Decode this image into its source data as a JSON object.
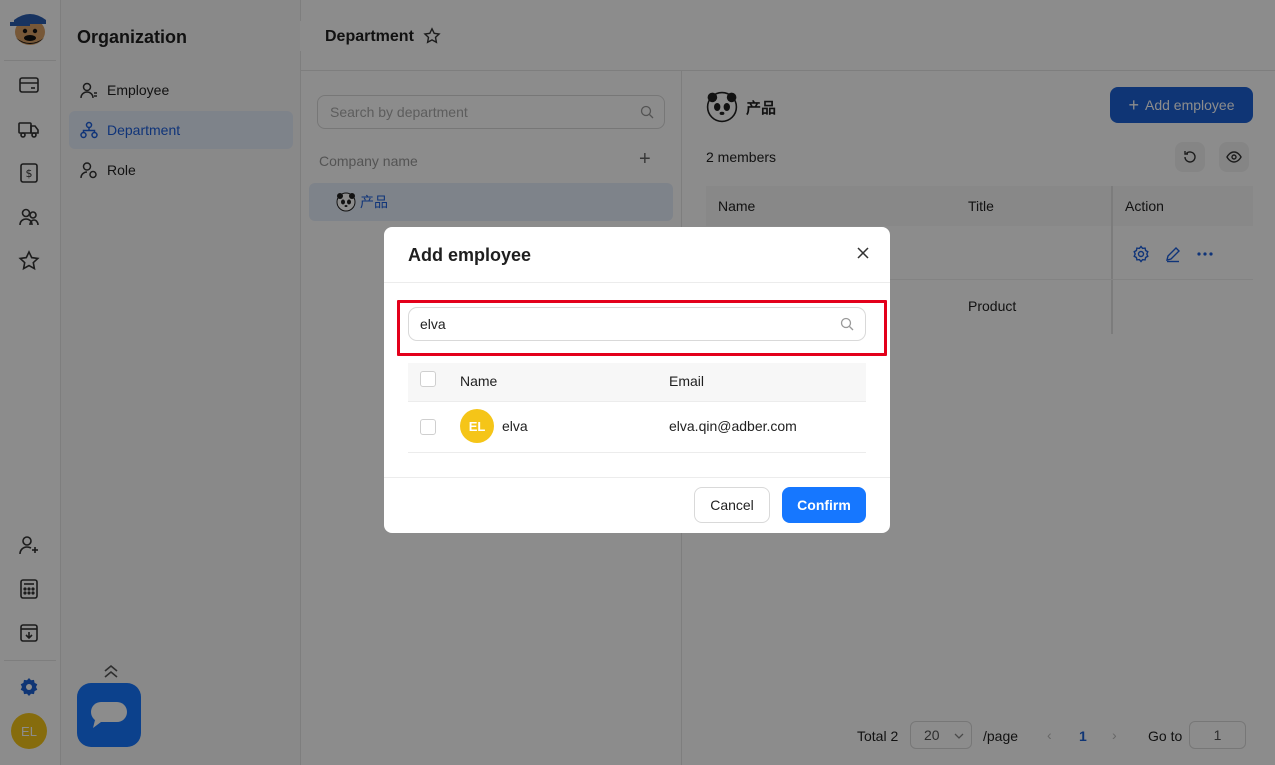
{
  "rail": {
    "icons": [
      "wallet-icon",
      "truck-icon",
      "dollar-icon",
      "users-icon",
      "star-icon"
    ],
    "bottom_icons": [
      "add-user-icon",
      "calculator-icon",
      "download-icon",
      "gear-icon"
    ],
    "avatar": "EL"
  },
  "sidebar": {
    "title": "Organization",
    "items": [
      {
        "label": "Employee",
        "icon": "employee-icon",
        "active": false
      },
      {
        "label": "Department",
        "icon": "org-chart-icon",
        "active": true
      },
      {
        "label": "Role",
        "icon": "role-icon",
        "active": false
      }
    ]
  },
  "header": {
    "title": "Department"
  },
  "tree": {
    "search_placeholder": "Search by department",
    "company_label": "Company name",
    "node_label": "产品"
  },
  "main": {
    "dept_name": "产品",
    "add_button": "Add employee",
    "members": "2 members",
    "columns": [
      "Name",
      "Title",
      "Action"
    ],
    "rows": [
      {
        "name": "",
        "title": ""
      },
      {
        "name": "",
        "title": "Product"
      }
    ]
  },
  "pagination": {
    "total": "Total 2",
    "page_size": "20",
    "per_page": "/page",
    "current": "1",
    "goto_label": "Go to",
    "goto_value": "1"
  },
  "modal": {
    "title": "Add employee",
    "search_value": "elva",
    "columns": [
      "Name",
      "Email"
    ],
    "rows": [
      {
        "initials": "EL",
        "name": "elva",
        "email": "elva.qin@adber.com"
      }
    ],
    "cancel": "Cancel",
    "confirm": "Confirm"
  },
  "colors": {
    "primary": "#1677ff",
    "avatar": "#f5c518",
    "highlight": "#e3001b"
  }
}
